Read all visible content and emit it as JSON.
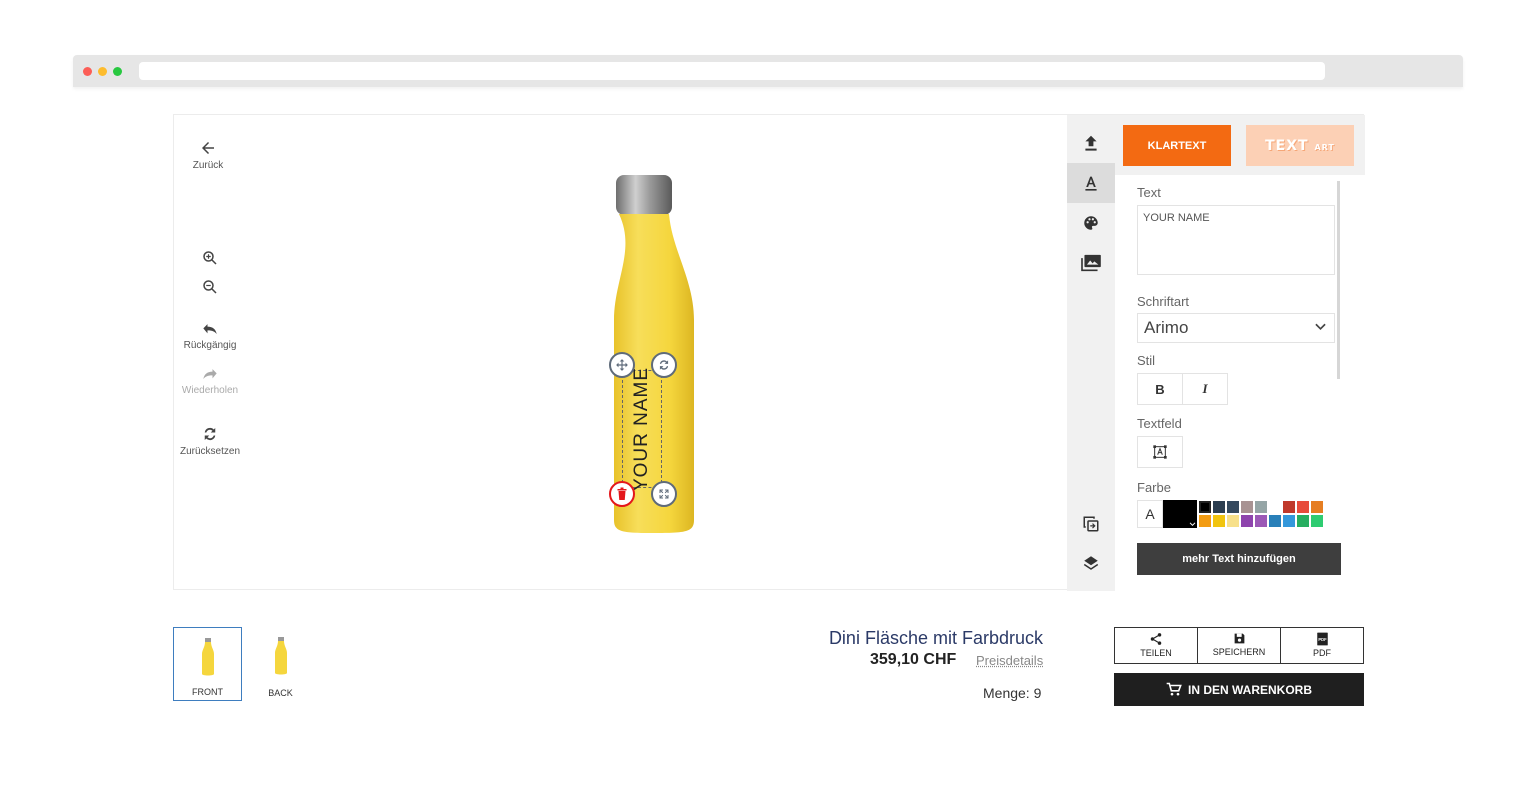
{
  "left_toolbar": {
    "back_label": "Zurück",
    "undo_label": "Rückgängig",
    "redo_label": "Wiederholen",
    "reset_label": "Zurücksetzen"
  },
  "canvas": {
    "text_on_bottle": "YOUR NAME",
    "bottle_color": "#f5d63d"
  },
  "panel": {
    "tab_plain": "KLARTEXT",
    "tab_textart_main": "TEXT",
    "tab_textart_small": "ART",
    "text_label": "Text",
    "text_value": "YOUR NAME",
    "font_label": "Schriftart",
    "font_value": "Arimo",
    "style_label": "Stil",
    "bold_label": "B",
    "italic_label": "I",
    "textfield_label": "Textfeld",
    "color_label": "Farbe",
    "color_letter": "A",
    "current_color": "#000000",
    "swatches": [
      "#000000",
      "#2c3e50",
      "#34495e",
      "#a89393",
      "#95a5a6",
      "#ffffff",
      "#c0392b",
      "#e74c3c",
      "#e67e22",
      "#f39c12",
      "#f1c40f",
      "#f7e08a",
      "#8e44ad",
      "#9b59b6",
      "#2980b9",
      "#3498db",
      "#27ae60",
      "#2ecc71"
    ],
    "add_text_button": "mehr Text hinzufügen"
  },
  "views": [
    {
      "label": "FRONT"
    },
    {
      "label": "BACK"
    }
  ],
  "product": {
    "title": "Dini Fläsche mit Farbdruck",
    "price": "359,10 CHF",
    "price_details": "Preisdetails",
    "quantity": "Menge: 9"
  },
  "actions": {
    "share": "TEILEN",
    "save": "SPEICHERN",
    "pdf": "PDF",
    "cart": "IN DEN WARENKORB"
  },
  "colors": {
    "accent": "#f36a12",
    "dark": "#1f1f1f"
  }
}
